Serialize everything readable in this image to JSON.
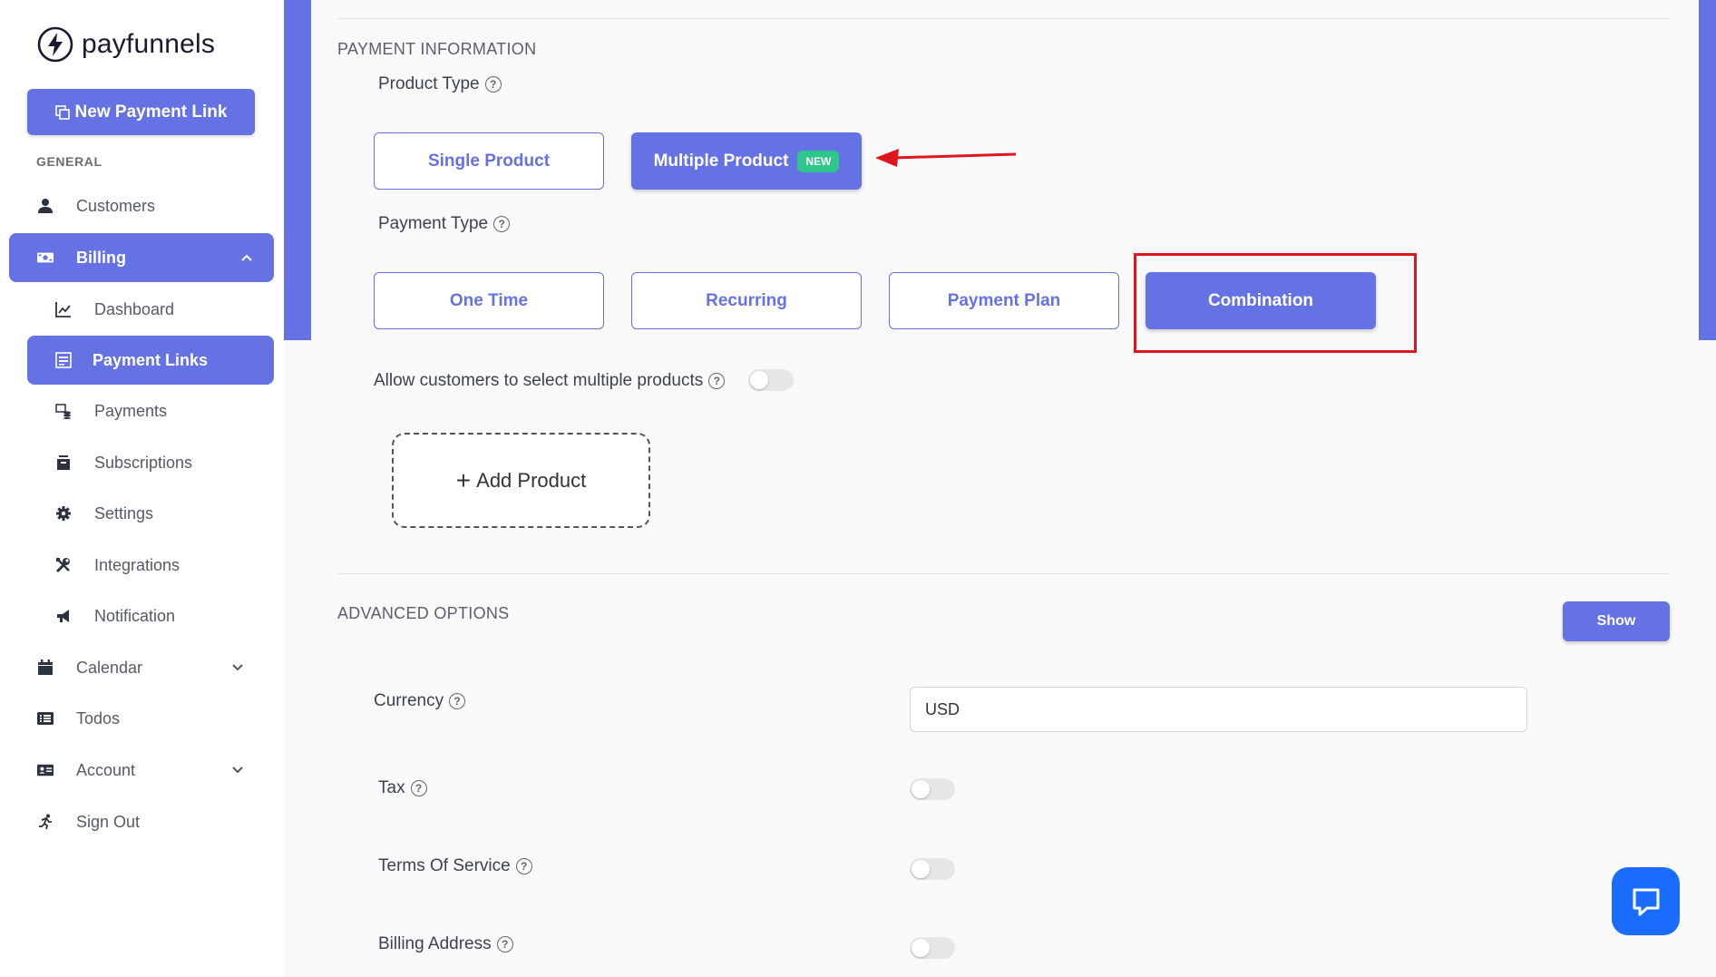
{
  "brand": {
    "name": "payfunnels"
  },
  "sidebar": {
    "new_link_label": "New Payment Link",
    "section_general": "GENERAL",
    "items": {
      "customers": "Customers",
      "billing": "Billing",
      "dashboard": "Dashboard",
      "payment_links": "Payment Links",
      "payments": "Payments",
      "subscriptions": "Subscriptions",
      "settings": "Settings",
      "integrations": "Integrations",
      "notification": "Notification",
      "calendar": "Calendar",
      "todos": "Todos",
      "account": "Account",
      "sign_out": "Sign Out"
    }
  },
  "payment_info": {
    "heading": "PAYMENT INFORMATION",
    "product_type_label": "Product Type",
    "product_types": {
      "single": "Single Product",
      "multiple": "Multiple Product",
      "new_badge": "NEW"
    },
    "payment_type_label": "Payment Type",
    "payment_types": {
      "one_time": "One Time",
      "recurring": "Recurring",
      "payment_plan": "Payment Plan",
      "combination": "Combination"
    },
    "allow_multiple_label": "Allow customers to select multiple products",
    "add_product_label": "Add Product"
  },
  "advanced": {
    "heading": "ADVANCED OPTIONS",
    "show_label": "Show",
    "currency_label": "Currency",
    "currency_value": "USD",
    "tax_label": "Tax",
    "terms_label": "Terms Of Service",
    "billing_address_label": "Billing Address"
  },
  "colors": {
    "accent": "#6572e3",
    "new_badge": "#2ec68a",
    "highlight": "#e0161e",
    "chat": "#1a6cff"
  }
}
